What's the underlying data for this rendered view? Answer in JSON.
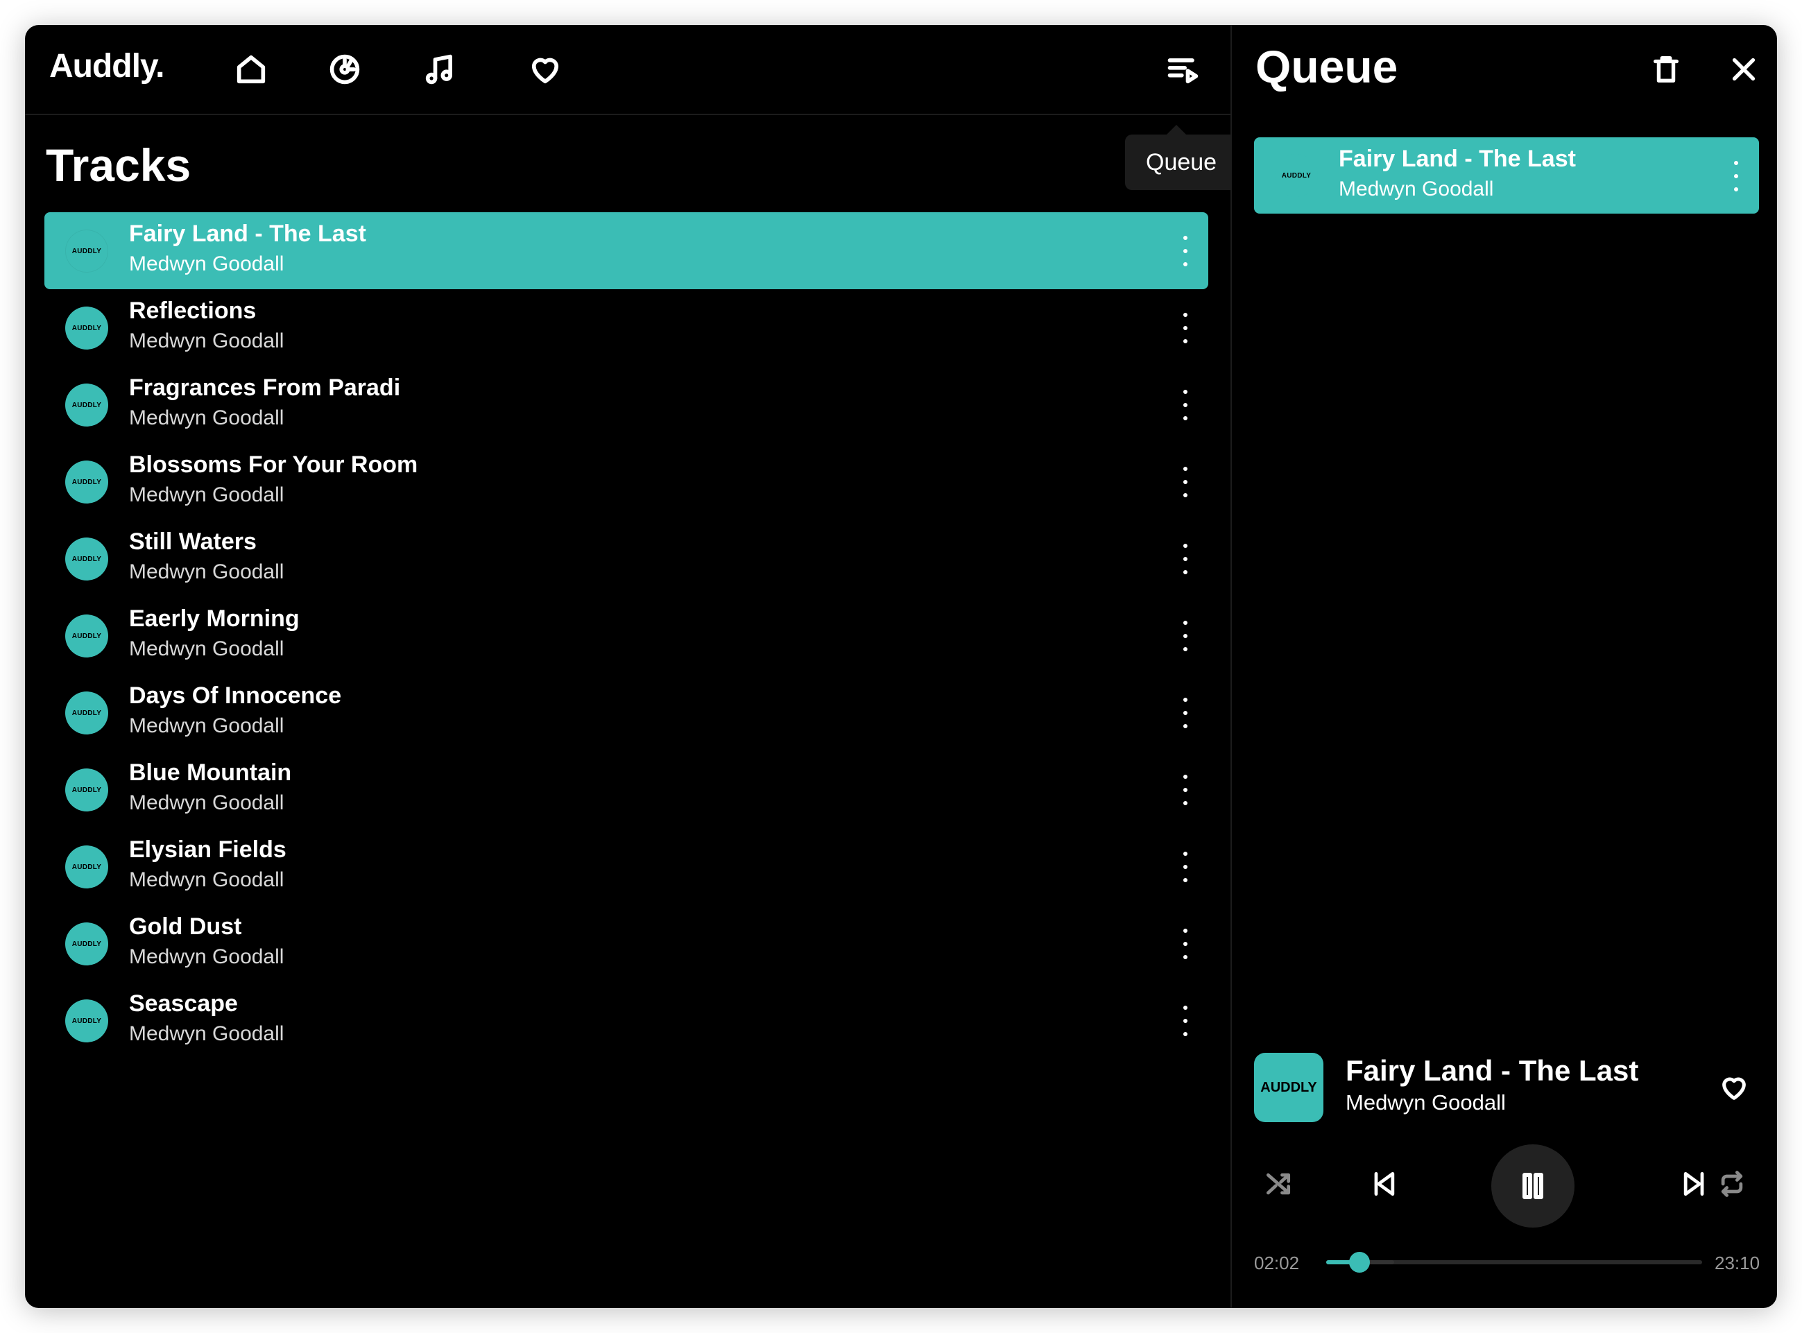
{
  "app": {
    "logo": "Auddly.",
    "accent_color": "#3bbdb5",
    "nav": [
      {
        "name": "home",
        "icon": "home-icon"
      },
      {
        "name": "albums",
        "icon": "disc-icon"
      },
      {
        "name": "tracks",
        "icon": "music-note-icon"
      },
      {
        "name": "favorites",
        "icon": "heart-icon"
      }
    ],
    "queue_toggle_icon": "queue-icon",
    "tooltip": "Queue"
  },
  "tracks": {
    "title": "Tracks",
    "art_label": "AUDDLY",
    "items": [
      {
        "title": "Fairy Land - The Last",
        "artist": "Medwyn Goodall",
        "active": true
      },
      {
        "title": "Reflections",
        "artist": "Medwyn Goodall"
      },
      {
        "title": "Fragrances From Paradi",
        "artist": "Medwyn Goodall"
      },
      {
        "title": "Blossoms For Your Room",
        "artist": "Medwyn Goodall"
      },
      {
        "title": "Still Waters",
        "artist": "Medwyn Goodall"
      },
      {
        "title": "Eaerly Morning",
        "artist": "Medwyn Goodall"
      },
      {
        "title": "Days Of Innocence",
        "artist": "Medwyn Goodall"
      },
      {
        "title": "Blue Mountain",
        "artist": "Medwyn Goodall"
      },
      {
        "title": "Elysian Fields",
        "artist": "Medwyn Goodall"
      },
      {
        "title": "Gold Dust",
        "artist": "Medwyn Goodall"
      },
      {
        "title": "Seascape",
        "artist": "Medwyn Goodall"
      }
    ]
  },
  "queue": {
    "title": "Queue",
    "clear_icon": "trash-icon",
    "close_icon": "close-icon",
    "items": [
      {
        "title": "Fairy Land - The Last",
        "artist": "Medwyn Goodall"
      }
    ]
  },
  "now_playing": {
    "art_label": "AUDDLY",
    "title": "Fairy Land - The Last",
    "artist": "Medwyn Goodall",
    "elapsed": "02:02",
    "duration": "23:10",
    "progress_fraction": 0.088
  }
}
